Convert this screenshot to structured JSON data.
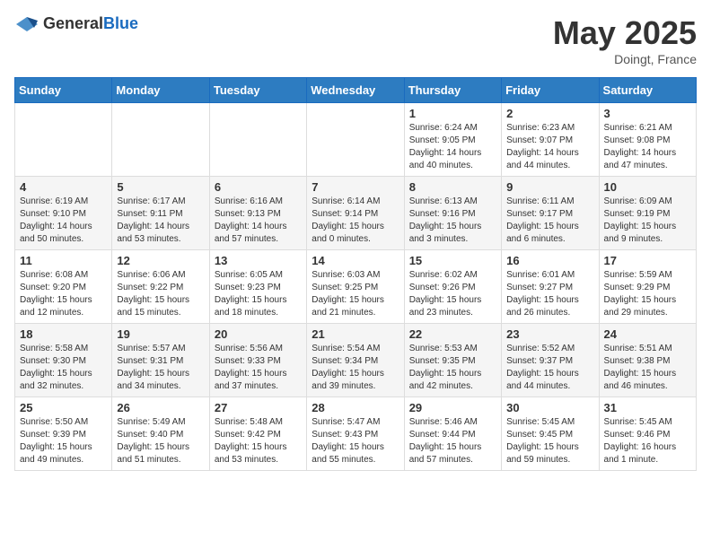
{
  "header": {
    "logo_general": "General",
    "logo_blue": "Blue",
    "month_year": "May 2025",
    "location": "Doingt, France"
  },
  "days_of_week": [
    "Sunday",
    "Monday",
    "Tuesday",
    "Wednesday",
    "Thursday",
    "Friday",
    "Saturday"
  ],
  "weeks": [
    [
      {
        "day": "",
        "info": ""
      },
      {
        "day": "",
        "info": ""
      },
      {
        "day": "",
        "info": ""
      },
      {
        "day": "",
        "info": ""
      },
      {
        "day": "1",
        "info": "Sunrise: 6:24 AM\nSunset: 9:05 PM\nDaylight: 14 hours\nand 40 minutes."
      },
      {
        "day": "2",
        "info": "Sunrise: 6:23 AM\nSunset: 9:07 PM\nDaylight: 14 hours\nand 44 minutes."
      },
      {
        "day": "3",
        "info": "Sunrise: 6:21 AM\nSunset: 9:08 PM\nDaylight: 14 hours\nand 47 minutes."
      }
    ],
    [
      {
        "day": "4",
        "info": "Sunrise: 6:19 AM\nSunset: 9:10 PM\nDaylight: 14 hours\nand 50 minutes."
      },
      {
        "day": "5",
        "info": "Sunrise: 6:17 AM\nSunset: 9:11 PM\nDaylight: 14 hours\nand 53 minutes."
      },
      {
        "day": "6",
        "info": "Sunrise: 6:16 AM\nSunset: 9:13 PM\nDaylight: 14 hours\nand 57 minutes."
      },
      {
        "day": "7",
        "info": "Sunrise: 6:14 AM\nSunset: 9:14 PM\nDaylight: 15 hours\nand 0 minutes."
      },
      {
        "day": "8",
        "info": "Sunrise: 6:13 AM\nSunset: 9:16 PM\nDaylight: 15 hours\nand 3 minutes."
      },
      {
        "day": "9",
        "info": "Sunrise: 6:11 AM\nSunset: 9:17 PM\nDaylight: 15 hours\nand 6 minutes."
      },
      {
        "day": "10",
        "info": "Sunrise: 6:09 AM\nSunset: 9:19 PM\nDaylight: 15 hours\nand 9 minutes."
      }
    ],
    [
      {
        "day": "11",
        "info": "Sunrise: 6:08 AM\nSunset: 9:20 PM\nDaylight: 15 hours\nand 12 minutes."
      },
      {
        "day": "12",
        "info": "Sunrise: 6:06 AM\nSunset: 9:22 PM\nDaylight: 15 hours\nand 15 minutes."
      },
      {
        "day": "13",
        "info": "Sunrise: 6:05 AM\nSunset: 9:23 PM\nDaylight: 15 hours\nand 18 minutes."
      },
      {
        "day": "14",
        "info": "Sunrise: 6:03 AM\nSunset: 9:25 PM\nDaylight: 15 hours\nand 21 minutes."
      },
      {
        "day": "15",
        "info": "Sunrise: 6:02 AM\nSunset: 9:26 PM\nDaylight: 15 hours\nand 23 minutes."
      },
      {
        "day": "16",
        "info": "Sunrise: 6:01 AM\nSunset: 9:27 PM\nDaylight: 15 hours\nand 26 minutes."
      },
      {
        "day": "17",
        "info": "Sunrise: 5:59 AM\nSunset: 9:29 PM\nDaylight: 15 hours\nand 29 minutes."
      }
    ],
    [
      {
        "day": "18",
        "info": "Sunrise: 5:58 AM\nSunset: 9:30 PM\nDaylight: 15 hours\nand 32 minutes."
      },
      {
        "day": "19",
        "info": "Sunrise: 5:57 AM\nSunset: 9:31 PM\nDaylight: 15 hours\nand 34 minutes."
      },
      {
        "day": "20",
        "info": "Sunrise: 5:56 AM\nSunset: 9:33 PM\nDaylight: 15 hours\nand 37 minutes."
      },
      {
        "day": "21",
        "info": "Sunrise: 5:54 AM\nSunset: 9:34 PM\nDaylight: 15 hours\nand 39 minutes."
      },
      {
        "day": "22",
        "info": "Sunrise: 5:53 AM\nSunset: 9:35 PM\nDaylight: 15 hours\nand 42 minutes."
      },
      {
        "day": "23",
        "info": "Sunrise: 5:52 AM\nSunset: 9:37 PM\nDaylight: 15 hours\nand 44 minutes."
      },
      {
        "day": "24",
        "info": "Sunrise: 5:51 AM\nSunset: 9:38 PM\nDaylight: 15 hours\nand 46 minutes."
      }
    ],
    [
      {
        "day": "25",
        "info": "Sunrise: 5:50 AM\nSunset: 9:39 PM\nDaylight: 15 hours\nand 49 minutes."
      },
      {
        "day": "26",
        "info": "Sunrise: 5:49 AM\nSunset: 9:40 PM\nDaylight: 15 hours\nand 51 minutes."
      },
      {
        "day": "27",
        "info": "Sunrise: 5:48 AM\nSunset: 9:42 PM\nDaylight: 15 hours\nand 53 minutes."
      },
      {
        "day": "28",
        "info": "Sunrise: 5:47 AM\nSunset: 9:43 PM\nDaylight: 15 hours\nand 55 minutes."
      },
      {
        "day": "29",
        "info": "Sunrise: 5:46 AM\nSunset: 9:44 PM\nDaylight: 15 hours\nand 57 minutes."
      },
      {
        "day": "30",
        "info": "Sunrise: 5:45 AM\nSunset: 9:45 PM\nDaylight: 15 hours\nand 59 minutes."
      },
      {
        "day": "31",
        "info": "Sunrise: 5:45 AM\nSunset: 9:46 PM\nDaylight: 16 hours\nand 1 minute."
      }
    ]
  ]
}
